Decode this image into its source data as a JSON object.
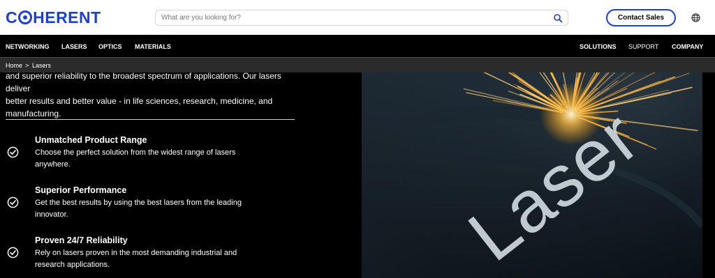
{
  "brand": {
    "logo_text_pre": "C",
    "logo_text_post": "HERENT",
    "accent": "#1d3fd6"
  },
  "search": {
    "placeholder": "What are you looking for?"
  },
  "header": {
    "contact_label": "Contact Sales"
  },
  "nav": {
    "left": [
      "NETWORKING",
      "LASERS",
      "OPTICS",
      "MATERIALS"
    ],
    "right": [
      "SOLUTIONS",
      "SUPPORT",
      "COMPANY"
    ]
  },
  "breadcrumb": {
    "home": "Home",
    "sep": ">",
    "current": "Lasers"
  },
  "intro": {
    "line1": "and superior reliability to the broadest spectrum of applications. Our lasers deliver",
    "line2": "better results and better value - in life sciences, research, medicine, and",
    "line3": "manufacturing."
  },
  "features": [
    {
      "title": "Unmatched Product Range",
      "text": "Choose the perfect solution from the widest range of lasers anywhere."
    },
    {
      "title": "Superior Performance",
      "text": "Get the best results by using the best lasers from the leading innovator."
    },
    {
      "title": "Proven 24/7 Reliability",
      "text": "Rely on lasers proven in the most demanding industrial and research applications."
    }
  ],
  "hero": {
    "engraved_text": "Laser"
  }
}
